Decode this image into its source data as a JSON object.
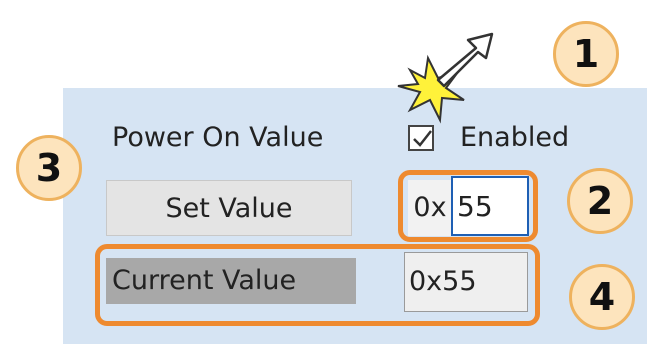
{
  "power_on": {
    "label": "Power On Value",
    "checkbox_checked": true,
    "enabled_label": "Enabled"
  },
  "set_value": {
    "button_label": "Set Value",
    "prefix": "0x",
    "input_value": "55"
  },
  "current_value": {
    "label": "Current Value",
    "value": "0x55"
  },
  "callouts": {
    "one": "1",
    "two": "2",
    "three": "3",
    "four": "4"
  },
  "colors": {
    "panel_background": "#d6e4f3",
    "callout_fill": "#fde4bd",
    "callout_border": "#eeb25e",
    "highlight_border": "#ee8a2f",
    "click_burst": "#fff23a"
  },
  "icons": [
    "checkmark-icon",
    "click-burst-icon",
    "pointer-arrow-icon"
  ]
}
